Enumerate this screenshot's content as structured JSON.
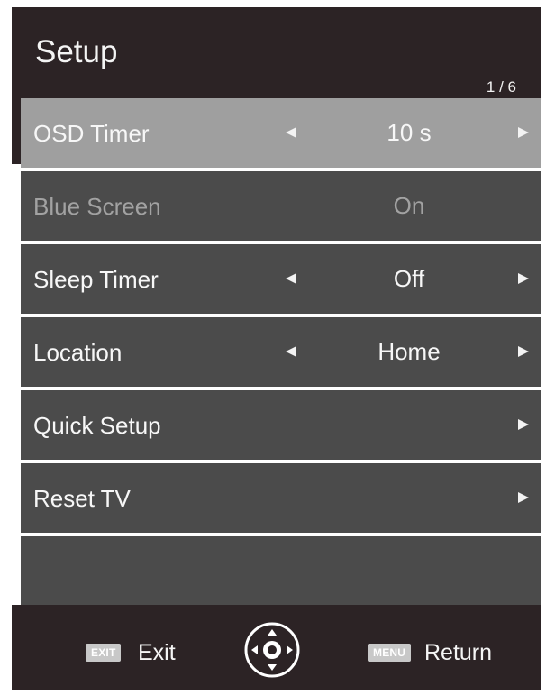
{
  "header": {
    "title": "Setup",
    "page_indicator": "1 / 6"
  },
  "menu": {
    "rows": [
      {
        "label": "OSD Timer",
        "value": "10 s"
      },
      {
        "label": "Blue Screen",
        "value": "On"
      },
      {
        "label": "Sleep Timer",
        "value": "Off"
      },
      {
        "label": "Location",
        "value": "Home"
      },
      {
        "label": "Quick Setup"
      },
      {
        "label": "Reset TV"
      }
    ]
  },
  "footer": {
    "exit_key": "EXIT",
    "exit_label": "Exit",
    "menu_key": "MENU",
    "return_label": "Return"
  },
  "icons": {
    "left_arrow": "left-arrow-icon",
    "right_arrow": "right-arrow-icon",
    "nav_pad": "directional-pad-icon"
  },
  "colors": {
    "frame": "#2c2325",
    "row": "#4b4b4b",
    "highlight": "#9f9f9f",
    "text": "#f7f7f7",
    "disabled_text": "#a2a2a2"
  }
}
